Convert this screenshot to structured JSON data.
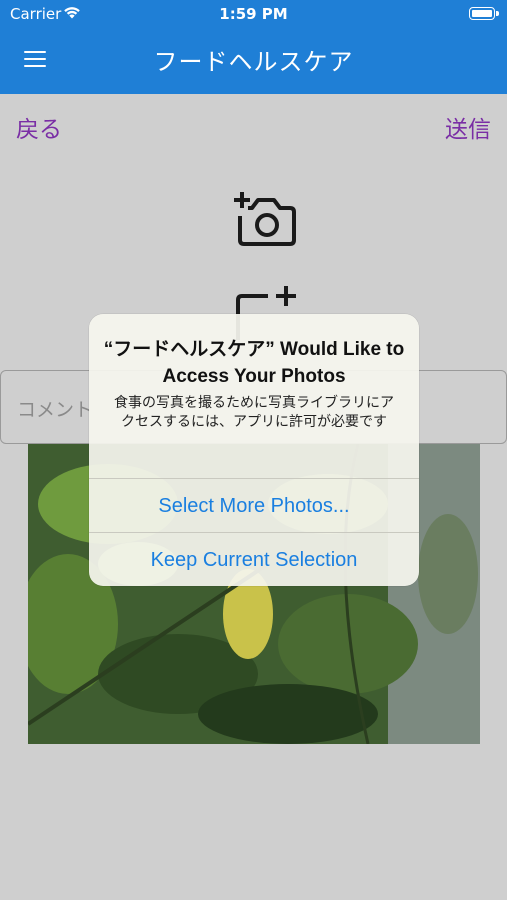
{
  "status_bar": {
    "carrier": "Carrier",
    "time": "1:59 PM"
  },
  "nav": {
    "title": "フードヘルスケア",
    "menu_icon": "hamburger-menu-icon"
  },
  "content": {
    "back_label": "戻る",
    "send_label": "送信",
    "camera_icon": "add-camera-icon",
    "gallery_icon": "add-photo-icon",
    "comment_placeholder": "コメント"
  },
  "alert": {
    "title": "“フードヘルスケア” Would Like to Access Your Photos",
    "message": "食事の写真を撮るために写真ライブラリにアクセスするには、アプリに許可が必要です",
    "buttons": [
      {
        "label": "Select More Photos..."
      },
      {
        "label": "Keep Current Selection"
      }
    ]
  },
  "colors": {
    "nav_bar": "#1f7fd6",
    "link_purple": "#7a2ea5",
    "alert_button_blue": "#1a7fe0",
    "background": "#cfcfcf"
  }
}
